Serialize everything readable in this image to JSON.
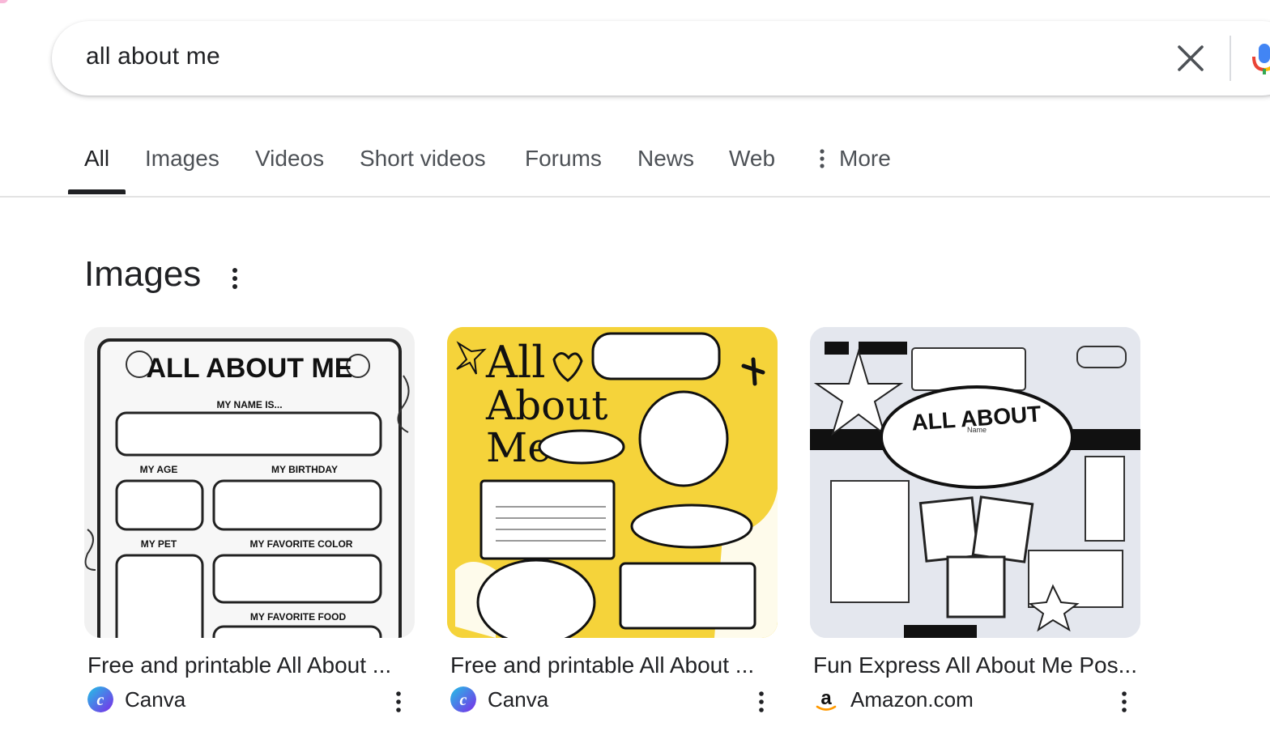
{
  "search": {
    "query": "all about me"
  },
  "tabs": [
    {
      "label": "All"
    },
    {
      "label": "Images"
    },
    {
      "label": "Videos"
    },
    {
      "label": "Short videos"
    },
    {
      "label": "Forums"
    },
    {
      "label": "News"
    },
    {
      "label": "Web"
    }
  ],
  "more_label": "More",
  "images_section": {
    "title": "Images",
    "results": [
      {
        "title": "Free and printable All About ...",
        "source": "Canva",
        "thumb_text": {
          "heading": "ALL ABOUT ME",
          "name": "MY NAME IS...",
          "age": "MY AGE",
          "birthday": "MY BIRTHDAY",
          "pet": "MY PET",
          "color": "MY FAVORITE COLOR",
          "food": "MY FAVORITE FOOD"
        }
      },
      {
        "title": "Free and printable All About ...",
        "source": "Canva",
        "thumb_text": {
          "line1": "All",
          "line2": "About",
          "line3": "Me"
        }
      },
      {
        "title": "Fun Express All About Me Pos...",
        "source": "Amazon.com",
        "thumb_text": {
          "heading": "ALL ABOUT",
          "sub": "Name"
        }
      }
    ]
  },
  "colors": {
    "canva_blue": "#2f6ee8",
    "canva_purple": "#7d2ae8",
    "thumb_yellow": "#f5d33a"
  }
}
